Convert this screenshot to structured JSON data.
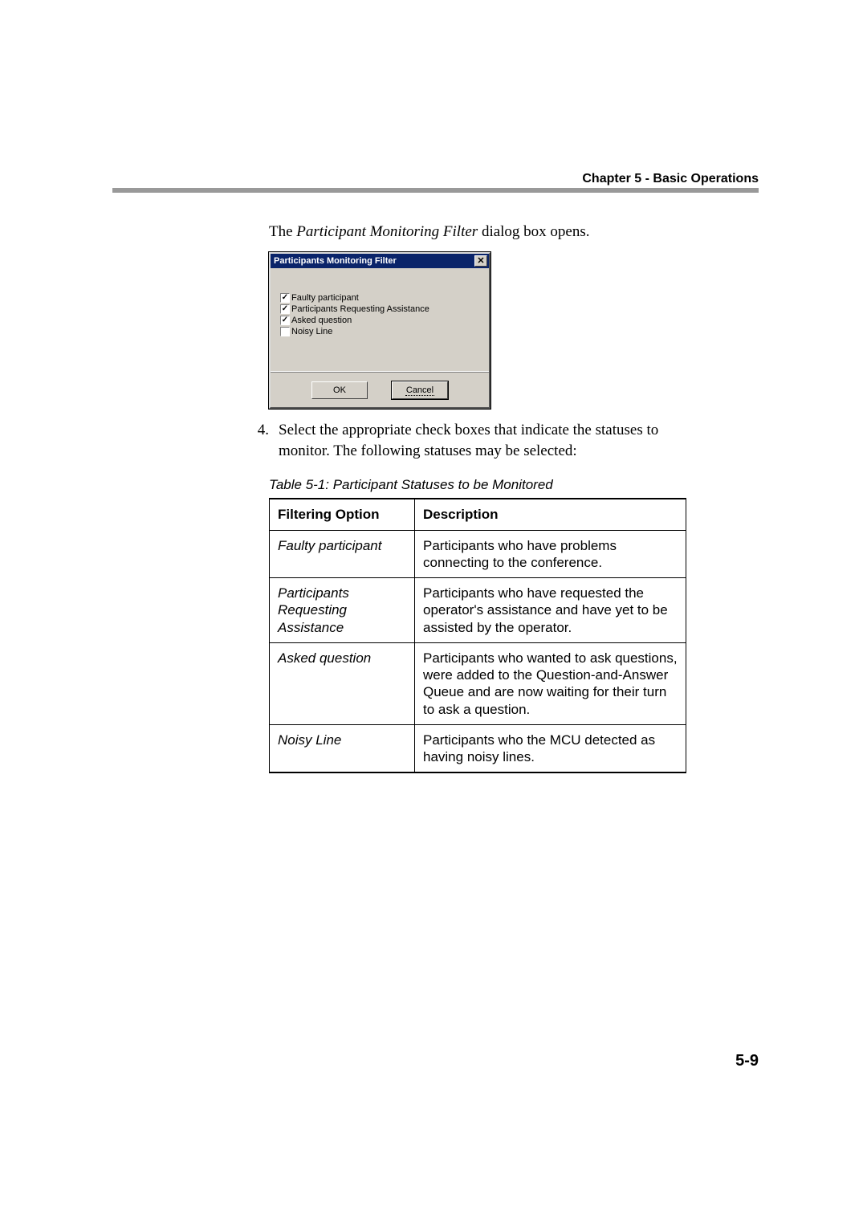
{
  "header": {
    "chapter_label": "Chapter 5 - Basic Operations"
  },
  "intro": {
    "prefix": "The ",
    "italic": "Participant Monitoring Filter",
    "suffix": " dialog box opens."
  },
  "dialog": {
    "title": "Participants Monitoring Filter",
    "close_glyph": "✕",
    "checks": [
      {
        "label": "Faulty participant",
        "checked": true
      },
      {
        "label": "Participants Requesting Assistance",
        "checked": true
      },
      {
        "label": "Asked question",
        "checked": true
      },
      {
        "label": "Noisy Line",
        "checked": false
      }
    ],
    "ok_label": "OK",
    "cancel_label": "Cancel"
  },
  "step": {
    "number": "4.",
    "text": "Select the appropriate check boxes that indicate the statuses to monitor. The following statuses may be selected:"
  },
  "table": {
    "caption": "Table 5-1: Participant Statuses to be Monitored",
    "headers": {
      "option": "Filtering Option",
      "desc": "Description"
    },
    "rows": [
      {
        "option": "Faulty participant",
        "desc": "Participants who have problems connecting to the conference."
      },
      {
        "option": "Participants Requesting Assistance",
        "desc": "Participants who have requested the operator's assistance and have yet to be assisted by the operator."
      },
      {
        "option": "Asked question",
        "desc": "Participants who wanted to ask questions, were added to the Question-and-Answer Queue and are now waiting for their turn to ask a question."
      },
      {
        "option": "Noisy Line",
        "desc": "Participants who the MCU detected as having noisy lines."
      }
    ]
  },
  "page_number": "5-9"
}
